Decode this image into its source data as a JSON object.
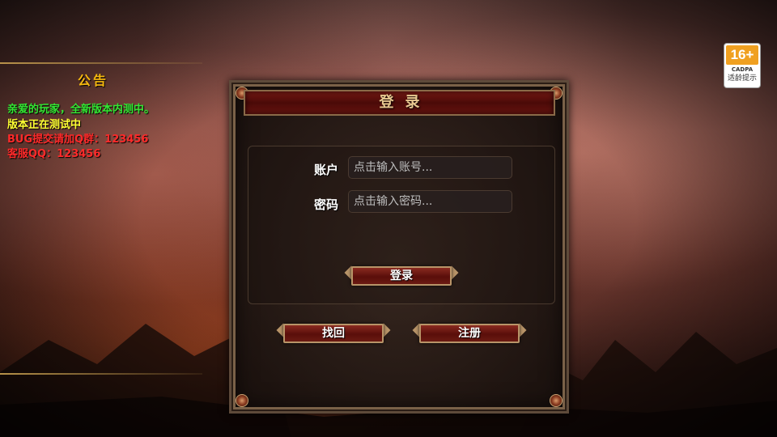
{
  "notice": {
    "title": "公告",
    "lines": [
      {
        "text": "亲爱的玩家，全新版本内测中。",
        "color": "#33e633"
      },
      {
        "text": "版本正在测试中",
        "color": "#ffff33"
      },
      {
        "text": "BUG提交请加Q群：123456",
        "color": "#ff2a2a"
      },
      {
        "text": "客服QQ：123456",
        "color": "#ff2a2a"
      }
    ]
  },
  "age_rating": {
    "age": "16+",
    "org": "CADPA",
    "tip": "适龄提示"
  },
  "login": {
    "title": "登录",
    "account_label": "账户",
    "account_placeholder": "点击输入账号...",
    "account_value": "",
    "password_label": "密码",
    "password_placeholder": "点击输入密码...",
    "password_value": "",
    "login_button": "登录",
    "recover_button": "找回",
    "register_button": "注册"
  },
  "colors": {
    "accent_gold": "#f5b80f",
    "button_red": "#6a1a12",
    "frame": "#b89468"
  }
}
